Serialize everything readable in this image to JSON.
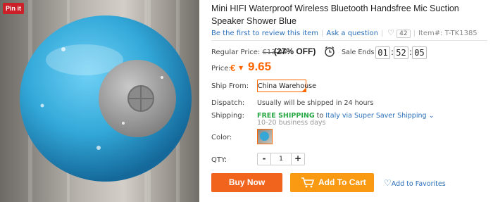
{
  "pin_label": "Pin it",
  "title": "Mini HIFI Waterproof Wireless Bluetooth Handsfree Mic Suction Speaker Shower Blue",
  "review_link": "Be the first to review this item",
  "ask_link": "Ask a question",
  "likes": "42",
  "item_no": "Item#: T-TK1385",
  "regular_price_label": "Regular Price:",
  "regular_price": "€13.05",
  "discount": "(27% OFF)",
  "sale_ends_label": "Sale Ends in",
  "countdown": {
    "h": "01",
    "m": "52",
    "s": "05"
  },
  "price_label": "Price:",
  "currency": "€",
  "price": "9.65",
  "ship_from_label": "Ship From:",
  "ship_from_value": "China Warehouse",
  "dispatch_label": "Dispatch:",
  "dispatch_value": "Usually will be shipped in 24 hours",
  "shipping_label": "Shipping:",
  "free_shipping": "FREE SHIPPING",
  "shipping_to": "to",
  "shipping_method": "Italy via Super Saver Shipping",
  "business_days": "10-20 business days",
  "color_label": "Color:",
  "qty_label": "QTY:",
  "qty_value": "1",
  "qty_minus": "-",
  "qty_plus": "+",
  "buy_now": "Buy Now",
  "add_to_cart": "Add To Cart",
  "add_to_favorites": "Add to Favorites",
  "colors": {
    "accent": "#f60",
    "buy": "#f1641e",
    "cart": "#fa9a13",
    "link": "#2a6fb9",
    "free": "#28a745",
    "speaker": "#35a7d6"
  }
}
